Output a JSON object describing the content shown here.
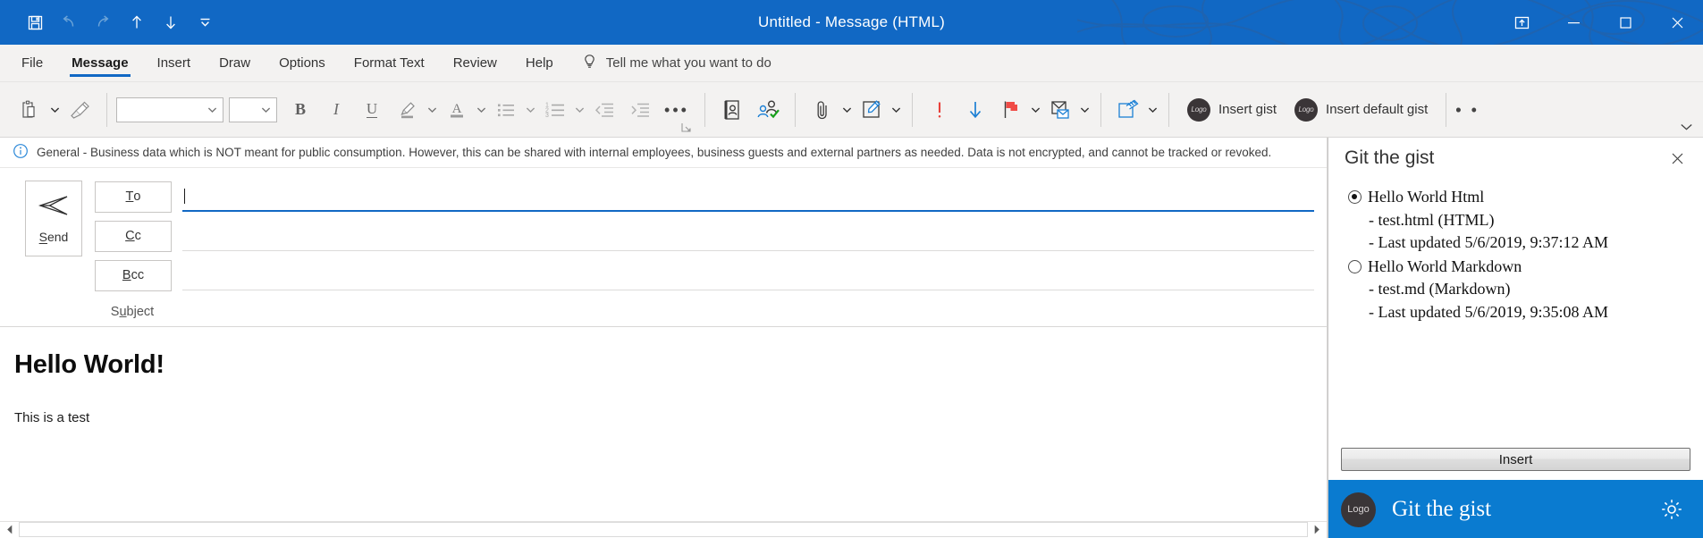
{
  "window": {
    "title": "Untitled  -  Message (HTML)",
    "quick_access": [
      {
        "name": "save-icon",
        "label": "Save",
        "disabled": false
      },
      {
        "name": "undo-icon",
        "label": "Undo",
        "disabled": true
      },
      {
        "name": "redo-icon",
        "label": "Redo",
        "disabled": true
      },
      {
        "name": "previous-item-icon",
        "label": "Previous Item",
        "disabled": false
      },
      {
        "name": "next-item-icon",
        "label": "Next Item",
        "disabled": false
      },
      {
        "name": "customize-quick-access-toolbar-icon",
        "label": "Customize Quick Access Toolbar",
        "disabled": false
      }
    ],
    "controls": [
      {
        "name": "ribbon-display-options-icon",
        "label": "Ribbon Display Options"
      },
      {
        "name": "minimize-icon",
        "label": "Minimize"
      },
      {
        "name": "maximize-icon",
        "label": "Maximize"
      },
      {
        "name": "close-icon",
        "label": "Close"
      }
    ]
  },
  "colors": {
    "titlebar": "#1168c4",
    "accent": "#1168c4",
    "brandbar": "#0a7bd0",
    "ribbon_bg": "#f3f2f1",
    "high_importance": "#e81123",
    "low_importance": "#1168c4"
  },
  "tabs": [
    {
      "label": "File",
      "active": false
    },
    {
      "label": "Message",
      "active": true
    },
    {
      "label": "Insert",
      "active": false
    },
    {
      "label": "Draw",
      "active": false
    },
    {
      "label": "Options",
      "active": false
    },
    {
      "label": "Format Text",
      "active": false
    },
    {
      "label": "Review",
      "active": false
    },
    {
      "label": "Help",
      "active": false
    }
  ],
  "tell_me": {
    "label": "Tell me what you want to do",
    "icon": "lightbulb-icon"
  },
  "ribbon": {
    "font_name_value": "",
    "font_size_value": "",
    "commands": [
      {
        "name": "paste-button",
        "label": "Paste"
      },
      {
        "name": "format-painter-button",
        "label": "Format Painter"
      },
      {
        "name": "bold-button",
        "label": "Bold"
      },
      {
        "name": "italic-button",
        "label": "Italic"
      },
      {
        "name": "underline-button",
        "label": "Underline"
      },
      {
        "name": "text-highlight-color-button",
        "label": "Text Highlight Color"
      },
      {
        "name": "font-color-button",
        "label": "Font Color"
      },
      {
        "name": "bullets-button",
        "label": "Bullets"
      },
      {
        "name": "numbering-button",
        "label": "Numbering"
      },
      {
        "name": "decrease-indent-button",
        "label": "Decrease Indent"
      },
      {
        "name": "increase-indent-button",
        "label": "Increase Indent"
      },
      {
        "name": "more-formatting-button",
        "label": "More"
      },
      {
        "name": "address-book-button",
        "label": "Address Book"
      },
      {
        "name": "check-names-button",
        "label": "Check Names"
      },
      {
        "name": "attach-file-button",
        "label": "Attach File"
      },
      {
        "name": "signature-button",
        "label": "Signature"
      },
      {
        "name": "high-importance-button",
        "label": "High Importance"
      },
      {
        "name": "low-importance-button",
        "label": "Low Importance"
      },
      {
        "name": "follow-up-button",
        "label": "Follow Up"
      },
      {
        "name": "mail-options-button",
        "label": "Mail Options"
      },
      {
        "name": "view-templates-button",
        "label": "View Templates"
      }
    ],
    "addins": [
      {
        "label": "Insert gist",
        "logo_text": "Logo"
      },
      {
        "label": "Insert default gist",
        "logo_text": "Logo"
      }
    ],
    "overflow_label": "• • •"
  },
  "banner": {
    "icon": "info-icon",
    "text": "General - Business data which is NOT meant for public consumption. However, this can be shared with internal employees, business guests and external partners as needed. Data is not encrypted, and cannot be tracked or revoked."
  },
  "compose": {
    "send_label": "Send",
    "send_accesskey": "S",
    "fields": [
      {
        "name": "to",
        "label": "To",
        "value": "",
        "focused": true
      },
      {
        "name": "cc",
        "label": "Cc",
        "value": "",
        "focused": false
      },
      {
        "name": "bcc",
        "label": "Bcc",
        "value": "",
        "focused": false
      }
    ],
    "subject_label": "Subject",
    "subject_value": "",
    "body": {
      "heading": "Hello World!",
      "paragraph": "This is a test"
    }
  },
  "task_pane": {
    "title": "Git the gist",
    "close_label": "✕",
    "options": [
      {
        "label": "Hello World Html",
        "selected": true,
        "file": "- test.html (HTML)",
        "updated": "- Last updated 5/6/2019, 9:37:12 AM"
      },
      {
        "label": "Hello World Markdown",
        "selected": false,
        "file": "- test.md (Markdown)",
        "updated": "- Last updated 5/6/2019, 9:35:08 AM"
      }
    ],
    "insert_button": "Insert",
    "brand": {
      "logo_text": "Logo",
      "name": "Git the gist",
      "settings_icon": "gear-icon"
    }
  }
}
